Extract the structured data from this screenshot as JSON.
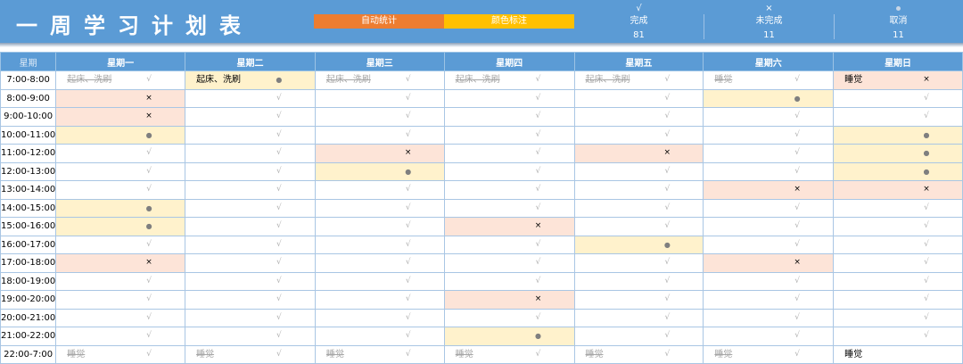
{
  "header": {
    "title": "一周学习计划表",
    "badges": [
      "自动统计",
      "颜色标注"
    ],
    "stats": [
      {
        "symbol": "√",
        "label": "完成",
        "value": "81"
      },
      {
        "symbol": "×",
        "label": "未完成",
        "value": "11"
      },
      {
        "symbol": "dot",
        "label": "取消",
        "value": "11"
      }
    ]
  },
  "colors": {
    "header_bg": "#5b9bd5",
    "auto_badge": "#ed7d31",
    "color_badge": "#ffc000",
    "incomplete_bg": "#fde4d8",
    "cancelled_bg": "#fff2cc"
  },
  "table": {
    "time_header": "星期",
    "days": [
      "星期一",
      "星期二",
      "星期三",
      "星期四",
      "星期五",
      "星期六",
      "星期日"
    ],
    "rows": [
      {
        "time": "7:00-8:00",
        "cells": [
          {
            "s": "done",
            "note": "起床、洗刷"
          },
          {
            "s": "cancel",
            "note": "起床、洗刷"
          },
          {
            "s": "done",
            "note": "起床、洗刷"
          },
          {
            "s": "done",
            "note": "起床、洗刷"
          },
          {
            "s": "done",
            "note": "起床、洗刷"
          },
          {
            "s": "done",
            "note": "睡觉"
          },
          {
            "s": "fail",
            "note": "睡觉"
          }
        ]
      },
      {
        "time": "8:00-9:00",
        "cells": [
          {
            "s": "fail"
          },
          {
            "s": "done"
          },
          {
            "s": "done"
          },
          {
            "s": "done"
          },
          {
            "s": "done"
          },
          {
            "s": "cancel"
          },
          {
            "s": "done"
          }
        ]
      },
      {
        "time": "9:00-10:00",
        "cells": [
          {
            "s": "fail"
          },
          {
            "s": "done"
          },
          {
            "s": "done"
          },
          {
            "s": "done"
          },
          {
            "s": "done"
          },
          {
            "s": "done"
          },
          {
            "s": "done"
          }
        ]
      },
      {
        "time": "10:00-11:00",
        "cells": [
          {
            "s": "cancel"
          },
          {
            "s": "done"
          },
          {
            "s": "done"
          },
          {
            "s": "done"
          },
          {
            "s": "done"
          },
          {
            "s": "done"
          },
          {
            "s": "cancel"
          }
        ]
      },
      {
        "time": "11:00-12:00",
        "cells": [
          {
            "s": "done"
          },
          {
            "s": "done"
          },
          {
            "s": "fail"
          },
          {
            "s": "done"
          },
          {
            "s": "fail"
          },
          {
            "s": "done"
          },
          {
            "s": "cancel"
          }
        ]
      },
      {
        "time": "12:00-13:00",
        "cells": [
          {
            "s": "done"
          },
          {
            "s": "done"
          },
          {
            "s": "cancel"
          },
          {
            "s": "done"
          },
          {
            "s": "done"
          },
          {
            "s": "done"
          },
          {
            "s": "cancel"
          }
        ]
      },
      {
        "time": "13:00-14:00",
        "cells": [
          {
            "s": "done"
          },
          {
            "s": "done"
          },
          {
            "s": "done"
          },
          {
            "s": "done"
          },
          {
            "s": "done"
          },
          {
            "s": "fail"
          },
          {
            "s": "fail"
          }
        ]
      },
      {
        "time": "14:00-15:00",
        "cells": [
          {
            "s": "cancel"
          },
          {
            "s": "done"
          },
          {
            "s": "done"
          },
          {
            "s": "done"
          },
          {
            "s": "done"
          },
          {
            "s": "done"
          },
          {
            "s": "done"
          }
        ]
      },
      {
        "time": "15:00-16:00",
        "cells": [
          {
            "s": "cancel"
          },
          {
            "s": "done"
          },
          {
            "s": "done"
          },
          {
            "s": "fail"
          },
          {
            "s": "done"
          },
          {
            "s": "done"
          },
          {
            "s": "done"
          }
        ]
      },
      {
        "time": "16:00-17:00",
        "cells": [
          {
            "s": "done"
          },
          {
            "s": "done"
          },
          {
            "s": "done"
          },
          {
            "s": "done"
          },
          {
            "s": "cancel"
          },
          {
            "s": "done"
          },
          {
            "s": "done"
          }
        ]
      },
      {
        "time": "17:00-18:00",
        "cells": [
          {
            "s": "fail"
          },
          {
            "s": "done"
          },
          {
            "s": "done"
          },
          {
            "s": "done"
          },
          {
            "s": "done"
          },
          {
            "s": "fail"
          },
          {
            "s": "done"
          }
        ]
      },
      {
        "time": "18:00-19:00",
        "cells": [
          {
            "s": "done"
          },
          {
            "s": "done"
          },
          {
            "s": "done"
          },
          {
            "s": "done"
          },
          {
            "s": "done"
          },
          {
            "s": "done"
          },
          {
            "s": "done"
          }
        ]
      },
      {
        "time": "19:00-20:00",
        "cells": [
          {
            "s": "done"
          },
          {
            "s": "done"
          },
          {
            "s": "done"
          },
          {
            "s": "fail"
          },
          {
            "s": "done"
          },
          {
            "s": "done"
          },
          {
            "s": "done"
          }
        ]
      },
      {
        "time": "20:00-21:00",
        "cells": [
          {
            "s": "done"
          },
          {
            "s": "done"
          },
          {
            "s": "done"
          },
          {
            "s": "done"
          },
          {
            "s": "done"
          },
          {
            "s": "done"
          },
          {
            "s": "done"
          }
        ]
      },
      {
        "time": "21:00-22:00",
        "cells": [
          {
            "s": "done"
          },
          {
            "s": "done"
          },
          {
            "s": "done"
          },
          {
            "s": "cancel"
          },
          {
            "s": "done"
          },
          {
            "s": "done"
          },
          {
            "s": "done"
          }
        ]
      },
      {
        "time": "22:00-7:00",
        "cells": [
          {
            "s": "done",
            "note": "睡觉"
          },
          {
            "s": "done",
            "note": "睡觉"
          },
          {
            "s": "done",
            "note": "睡觉"
          },
          {
            "s": "done",
            "note": "睡觉"
          },
          {
            "s": "done",
            "note": "睡觉"
          },
          {
            "s": "done",
            "note": "睡觉"
          },
          {
            "s": "plain",
            "note": "睡觉"
          }
        ]
      }
    ]
  }
}
